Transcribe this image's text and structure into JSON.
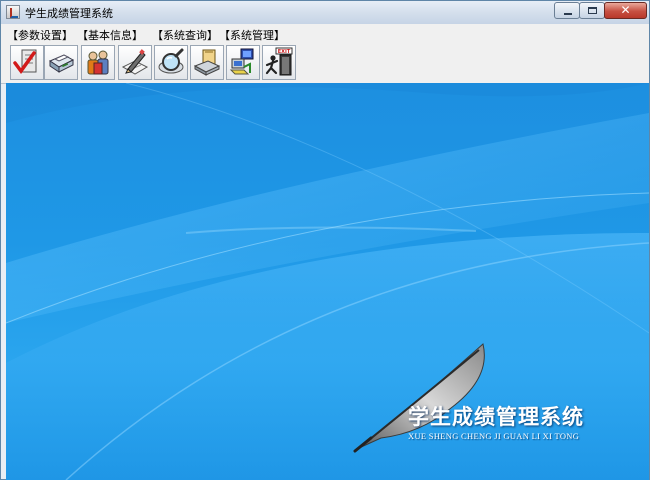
{
  "window": {
    "title": "学生成绩管理系统",
    "controls": {
      "minimize": "–",
      "maximize": "□",
      "close": "✕"
    }
  },
  "menubar": {
    "items": [
      {
        "label": "【参数设置】"
      },
      {
        "label": "【基本信息】"
      },
      {
        "label": "【系统查询】"
      },
      {
        "label": "【系统管理】"
      }
    ]
  },
  "toolbar": {
    "buttons": [
      {
        "icon": "checklist-icon"
      },
      {
        "icon": "printer-icon"
      },
      {
        "icon": "users-icon"
      },
      {
        "icon": "edit-document-icon"
      },
      {
        "icon": "search-magnifier-icon"
      },
      {
        "icon": "folder-computer-icon"
      },
      {
        "icon": "network-computer-icon"
      },
      {
        "icon": "exit-door-icon"
      }
    ]
  },
  "branding": {
    "title": "学生成绩管理系统",
    "subtitle": "XUE SHENG CHENG JI GUAN LI XI TONG",
    "exit_sign": "EXIT"
  },
  "colors": {
    "desktop_blue": "#1f98e6",
    "titlebar": "#d4dfec",
    "close_red": "#c75042"
  }
}
